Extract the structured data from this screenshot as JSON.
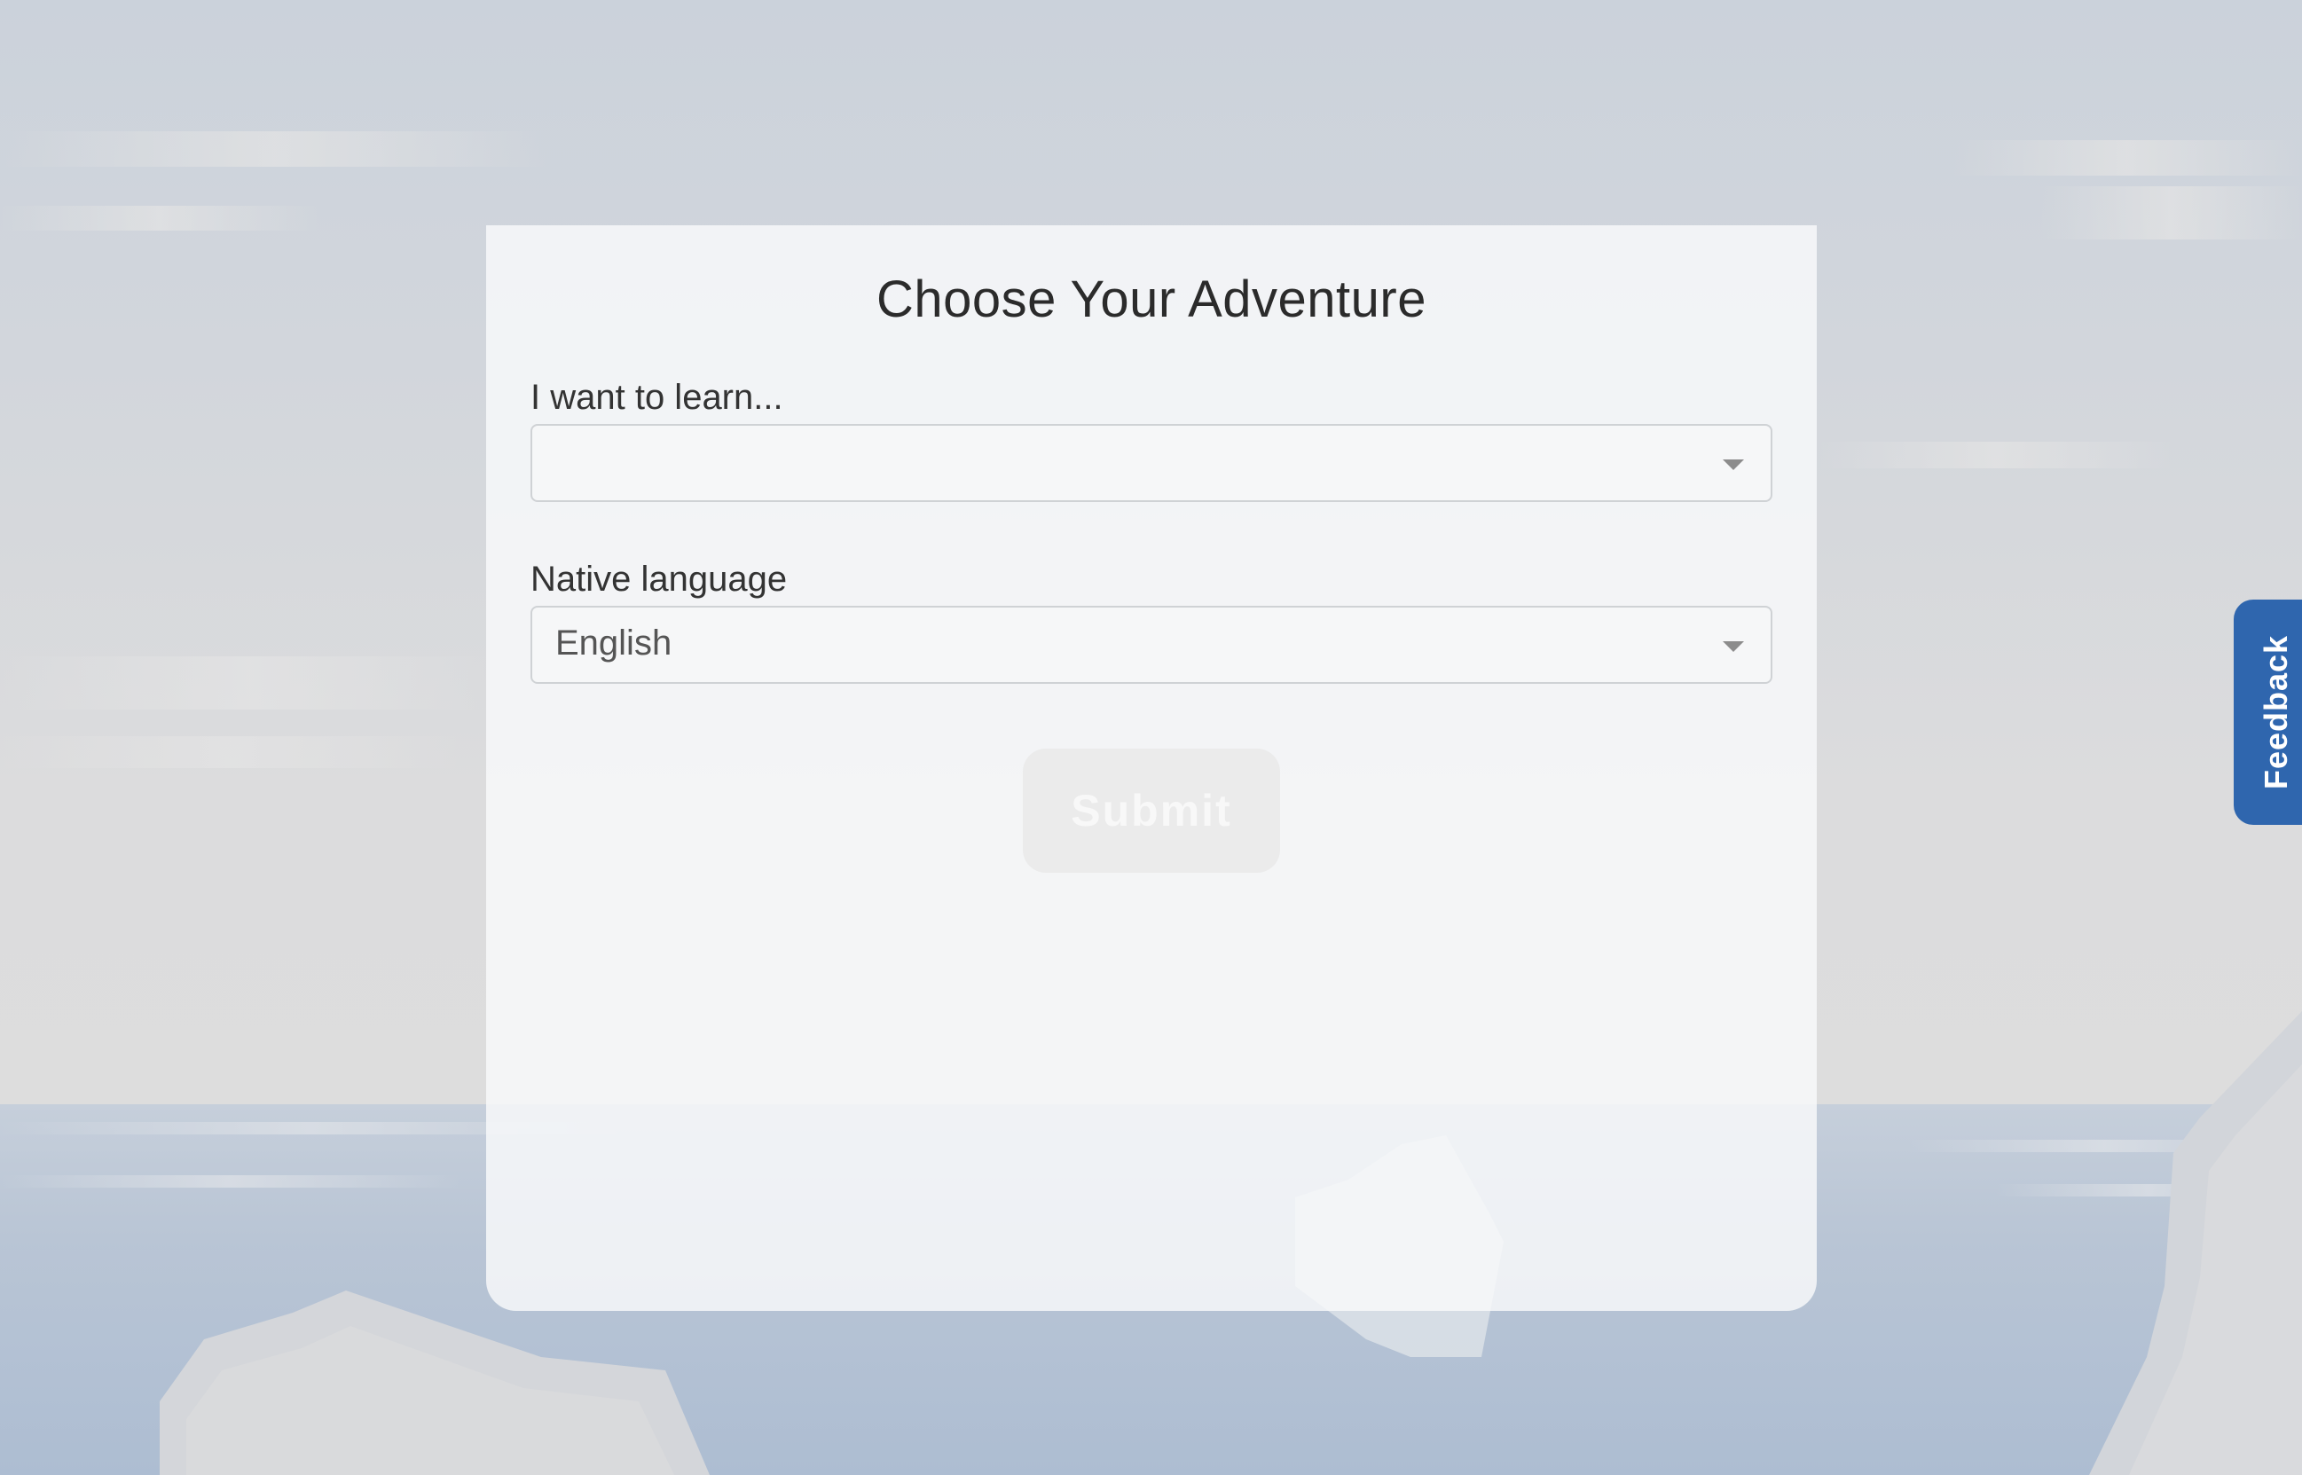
{
  "form": {
    "title": "Choose Your Adventure",
    "learn_label": "I want to learn...",
    "learn_value": "",
    "native_label": "Native language",
    "native_value": "English",
    "submit_label": "Submit"
  },
  "feedback": {
    "label": "Feedback"
  },
  "colors": {
    "feedback_tab": "#2f66ae",
    "submit_disabled_bg": "#ebebeb",
    "title_text": "#2b2b2b"
  },
  "icons": {
    "select_caret": "chevron-down-icon"
  }
}
